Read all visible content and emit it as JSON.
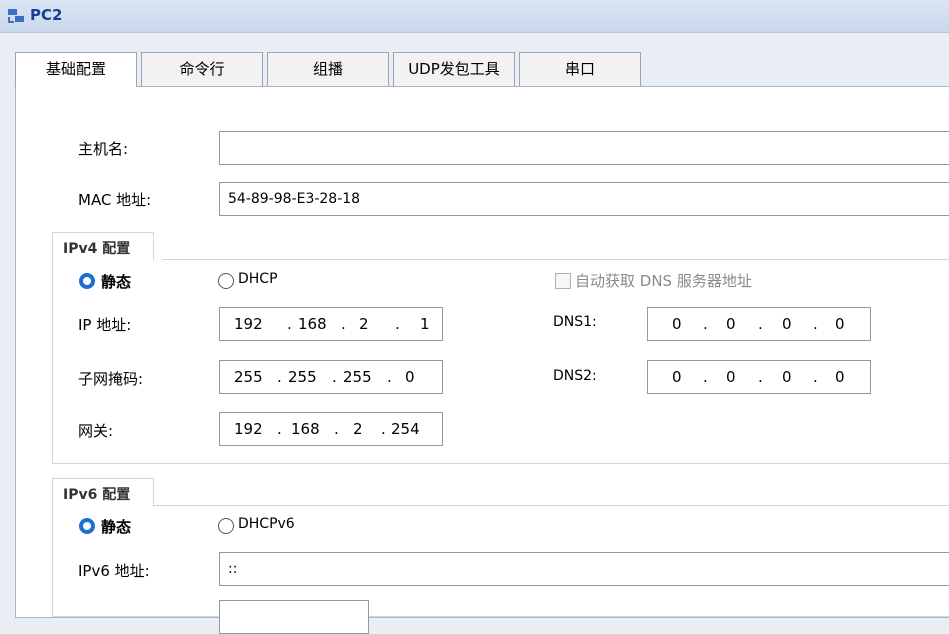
{
  "window": {
    "title": "PC2"
  },
  "tabs": [
    {
      "label": "基础配置"
    },
    {
      "label": "命令行"
    },
    {
      "label": "组播"
    },
    {
      "label": "UDP发包工具"
    },
    {
      "label": "串口"
    }
  ],
  "basic": {
    "hostname_label": "主机名:",
    "hostname_value": "",
    "mac_label": "MAC 地址:",
    "mac_value": "54-89-98-E3-28-18"
  },
  "ipv4": {
    "group_title": "IPv4 配置",
    "static_label": "静态",
    "dhcp_label": "DHCP",
    "auto_dns_label": "自动获取 DNS 服务器地址",
    "ip_label": "IP 地址:",
    "ip": [
      "192",
      "168",
      "2",
      "1"
    ],
    "mask_label": "子网掩码:",
    "mask": [
      "255",
      "255",
      "255",
      "0"
    ],
    "gateway_label": "网关:",
    "gateway": [
      "192",
      "168",
      "2",
      "254"
    ],
    "dns1_label": "DNS1:",
    "dns1": [
      "0",
      "0",
      "0",
      "0"
    ],
    "dns2_label": "DNS2:",
    "dns2": [
      "0",
      "0",
      "0",
      "0"
    ],
    "sep": "."
  },
  "ipv6": {
    "group_title": "IPv6 配置",
    "static_label": "静态",
    "dhcp_label": "DHCPv6",
    "addr_label": "IPv6 地址:",
    "addr_value": "::"
  }
}
